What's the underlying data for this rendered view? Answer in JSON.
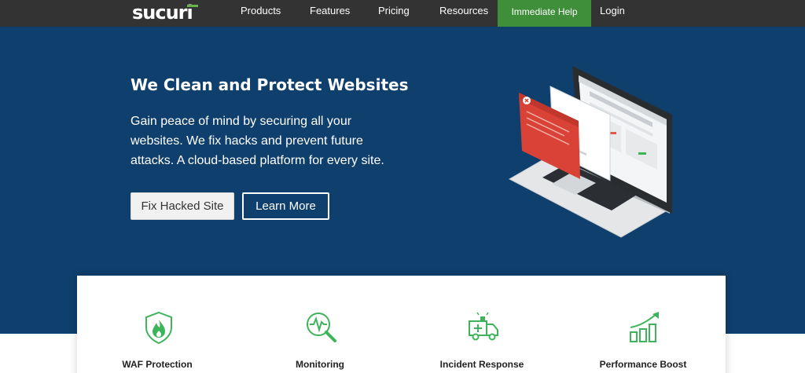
{
  "brand": {
    "logo_text": "sucuri"
  },
  "nav": {
    "items": [
      "Products",
      "Features",
      "Pricing",
      "Resources"
    ],
    "help_label": "Immediate Help",
    "login_label": "Login"
  },
  "hero": {
    "title": "We Clean and Protect Websites",
    "description": "Gain peace of mind by securing all your websites. We fix hacks and prevent future attacks. A cloud-based platform for every site.",
    "primary_button": "Fix Hacked Site",
    "secondary_button": "Learn More"
  },
  "features": [
    {
      "label": "WAF Protection",
      "icon": "shield-flame-icon"
    },
    {
      "label": "Monitoring",
      "icon": "magnifier-pulse-icon"
    },
    {
      "label": "Incident Response",
      "icon": "ambulance-icon"
    },
    {
      "label": "Performance Boost",
      "icon": "bar-chart-arrow-icon"
    }
  ],
  "colors": {
    "topbar": "#333333",
    "help_button": "#3f8f3a",
    "hero_bg": "#0f3f6c",
    "accent_green": "#3db45a"
  }
}
